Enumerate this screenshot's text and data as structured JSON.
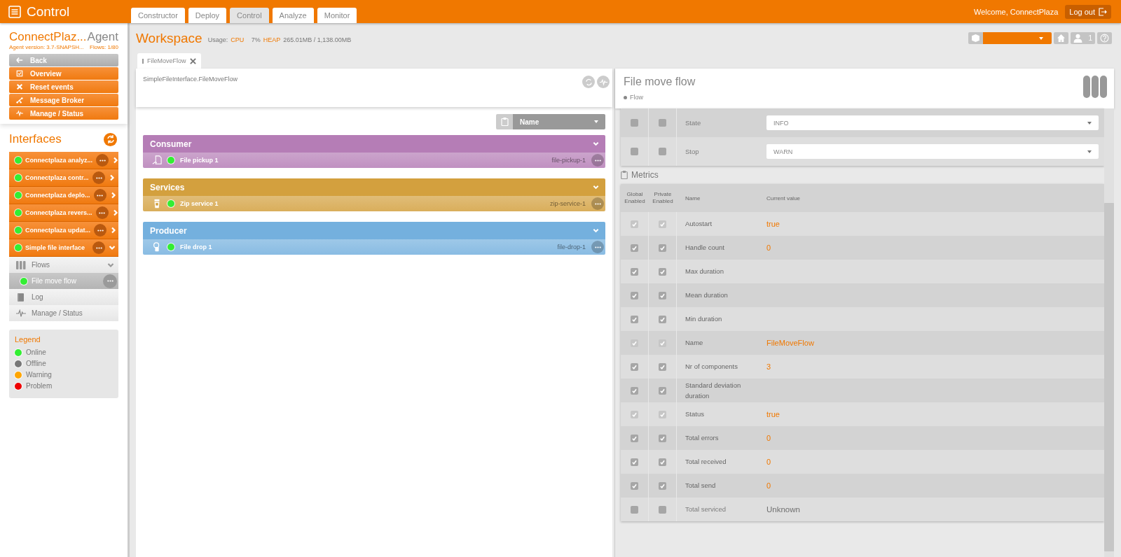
{
  "app_bar": {
    "title": "Control",
    "welcome": "Welcome, ConnectPlaza",
    "logout": "Log out"
  },
  "nav_tabs": [
    {
      "label": "Constructor",
      "selected": false
    },
    {
      "label": "Deploy",
      "selected": false
    },
    {
      "label": "Control",
      "selected": true
    },
    {
      "label": "Analyze",
      "selected": false
    },
    {
      "label": "Monitor",
      "selected": false
    }
  ],
  "agent": {
    "name": "ConnectPlaz...",
    "type": "Agent",
    "version": "Agent version: 3.7-SNAPSH...",
    "flows": "Flows: 1/80"
  },
  "agent_menu": [
    {
      "label": "Back",
      "kind": "back"
    },
    {
      "label": "Overview",
      "kind": "overview"
    },
    {
      "label": "Reset events",
      "kind": "reset"
    },
    {
      "label": "Message Broker",
      "kind": "broker"
    },
    {
      "label": "Manage / Status",
      "kind": "status"
    }
  ],
  "interfaces": {
    "title": "Interfaces",
    "items": [
      {
        "label": "Connectplaza analyz...",
        "color": "#33ee33",
        "expanded": false
      },
      {
        "label": "Connectplaza contr...",
        "color": "#33ee33",
        "expanded": false
      },
      {
        "label": "Connectplaza deplo...",
        "color": "#33ee33",
        "expanded": false
      },
      {
        "label": "Connectplaza revers...",
        "color": "#33ee33",
        "expanded": false
      },
      {
        "label": "Connectplaza updat...",
        "color": "#33ee33",
        "expanded": false
      },
      {
        "label": "Simple file interface",
        "color": "#33ee33",
        "expanded": true,
        "children": [
          {
            "label": "Flows",
            "kind": "flows",
            "expanded": true,
            "children": [
              {
                "label": "File move flow",
                "color": "#33ee33",
                "selected": true
              }
            ]
          },
          {
            "label": "Log",
            "kind": "log"
          },
          {
            "label": "Manage / Status",
            "kind": "status"
          }
        ]
      }
    ]
  },
  "legend": {
    "title": "Legend",
    "items": [
      {
        "label": "Online",
        "color": "#33ee33"
      },
      {
        "label": "Offline",
        "color": "#777777"
      },
      {
        "label": "Warning",
        "color": "#ffa500"
      },
      {
        "label": "Problem",
        "color": "#ee0000"
      }
    ]
  },
  "workspace": {
    "title": "Workspace",
    "usage_label": "Usage:",
    "cpu_label": "CPU",
    "cpu": "7%",
    "heap_label": "HEAP",
    "heap": "265.01MB / 1,138.00MB",
    "user_count": "1"
  },
  "editor_tabs": [
    {
      "label": "FileMoveFlow",
      "selected": true
    }
  ],
  "flow_panel": {
    "path": "SimpleFileInterface.FileMoveFlow",
    "sort": "Name",
    "groups": [
      {
        "title": "Consumer",
        "color": "#b57db6",
        "expanded": true,
        "components": [
          {
            "name": "File pickup 1",
            "slug": "file-pickup-1",
            "kind": "pickup",
            "color": "#33ee33"
          }
        ]
      },
      {
        "title": "Services",
        "color": "#d3a03e",
        "expanded": true,
        "components": [
          {
            "name": "Zip service 1",
            "slug": "zip-service-1",
            "kind": "zip",
            "color": "#33ee33"
          }
        ]
      },
      {
        "title": "Producer",
        "color": "#74b0de",
        "expanded": true,
        "components": [
          {
            "name": "File drop 1",
            "slug": "file-drop-1",
            "kind": "drop",
            "color": "#33ee33"
          }
        ]
      }
    ]
  },
  "detail": {
    "title": "File move flow",
    "subtitle": "Flow",
    "settings": [
      {
        "name": "State",
        "value": "INFO",
        "checked": false
      },
      {
        "name": "Stop",
        "value": "WARN",
        "checked": false
      }
    ],
    "metrics_title": "Metrics",
    "columns": [
      "Global Enabled",
      "Private Enabled",
      "Name",
      "Current value"
    ],
    "metrics": [
      {
        "name": "Autostart",
        "value": "true",
        "checked": true,
        "disabled": true,
        "unknown": false
      },
      {
        "name": "Handle count",
        "value": "0",
        "checked": true,
        "disabled": false,
        "unknown": false
      },
      {
        "name": "Max duration",
        "checked": true,
        "disabled": false
      },
      {
        "name": "Mean duration",
        "checked": true,
        "disabled": false
      },
      {
        "name": "Min duration",
        "checked": true,
        "disabled": false
      },
      {
        "name": "Name",
        "value": "FileMoveFlow",
        "checked": true,
        "disabled": true,
        "unknown": false
      },
      {
        "name": "Nr of components",
        "value": "3",
        "checked": true,
        "disabled": false,
        "unknown": false
      },
      {
        "name": "Standard deviation duration",
        "checked": true,
        "disabled": false
      },
      {
        "name": "Status",
        "value": "true",
        "checked": true,
        "disabled": true,
        "unknown": false
      },
      {
        "name": "Total errors",
        "value": "0",
        "checked": true,
        "disabled": false,
        "unknown": false
      },
      {
        "name": "Total received",
        "value": "0",
        "checked": true,
        "disabled": false,
        "unknown": false
      },
      {
        "name": "Total send",
        "value": "0",
        "checked": true,
        "disabled": false,
        "unknown": false
      },
      {
        "name": "Total serviced",
        "value": "Unknown",
        "checked": false,
        "disabled": false,
        "unknown": true
      }
    ]
  }
}
